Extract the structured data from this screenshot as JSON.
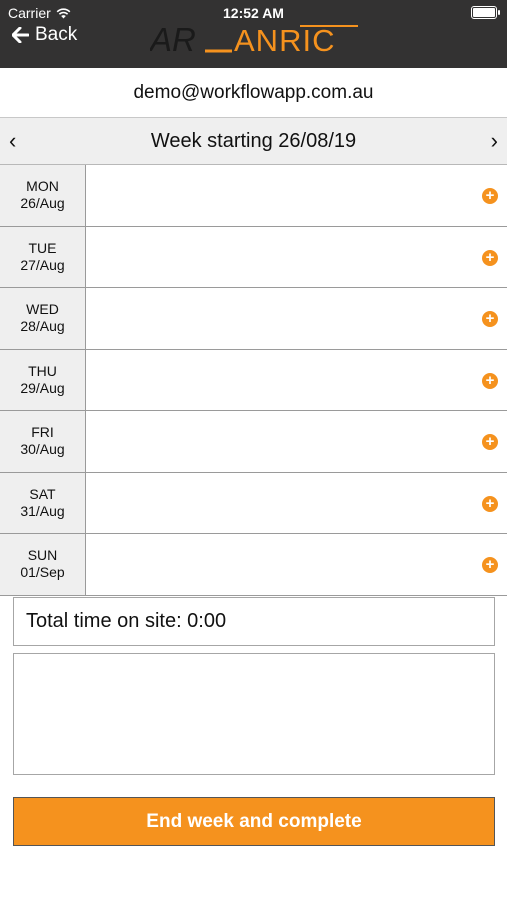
{
  "status": {
    "carrier": "Carrier",
    "time": "12:52 AM"
  },
  "header": {
    "back_label": "Back",
    "logo_text": "ANRIC",
    "logo_mark": "AR"
  },
  "account": {
    "email": "demo@workflowapp.com.au"
  },
  "week": {
    "title": "Week starting 26/08/19",
    "prev_icon": "‹",
    "next_icon": "›"
  },
  "days": [
    {
      "day": "MON",
      "date": "26/Aug"
    },
    {
      "day": "TUE",
      "date": "27/Aug"
    },
    {
      "day": "WED",
      "date": "28/Aug"
    },
    {
      "day": "THU",
      "date": "29/Aug"
    },
    {
      "day": "FRI",
      "date": "30/Aug"
    },
    {
      "day": "SAT",
      "date": "31/Aug"
    },
    {
      "day": "SUN",
      "date": "01/Sep"
    }
  ],
  "add_icon": "+",
  "total": {
    "label": "Total time on site: 0:00"
  },
  "notes": {
    "value": ""
  },
  "actions": {
    "end_week_label": "End week and complete"
  },
  "colors": {
    "accent": "#f5921e",
    "header_bg": "#333232",
    "row_label_bg": "#efefef"
  }
}
